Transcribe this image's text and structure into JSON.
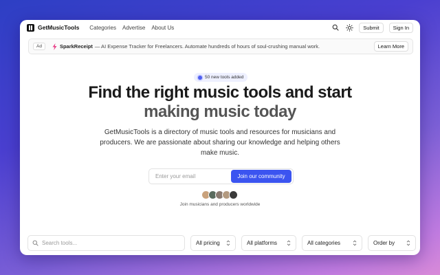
{
  "nav": {
    "brand": "GetMusicTools",
    "links": [
      "Categories",
      "Advertise",
      "About Us"
    ],
    "submit_label": "Submit",
    "signin_label": "Sign In"
  },
  "ad": {
    "tag": "Ad",
    "brand": "SparkReceipt",
    "text": "— AI Expense Tracker for Freelancers. Automate hundreds of hours of soul-crushing manual work.",
    "cta": "Learn More"
  },
  "hero": {
    "badge": "50 new tools added",
    "title_line1": "Find the right music tools and start",
    "title_line2": "making music today",
    "subtitle": "GetMusicTools is a directory of music tools and resources for musicians and producers. We are passionate about sharing our knowledge and helping others make music.",
    "email_placeholder": "Enter your email",
    "join_label": "Join our community",
    "join_caption": "Join musicians and producers worldwide"
  },
  "filters": {
    "search_placeholder": "Search tools...",
    "pricing": "All pricing",
    "platforms": "All platforms",
    "categories": "All categories",
    "order": "Order by"
  },
  "colors": {
    "accent": "#3b54f0",
    "avatars": [
      "#c9a27c",
      "#5a6b5e",
      "#8a7a70",
      "#b39a80",
      "#3a3a3a"
    ]
  }
}
